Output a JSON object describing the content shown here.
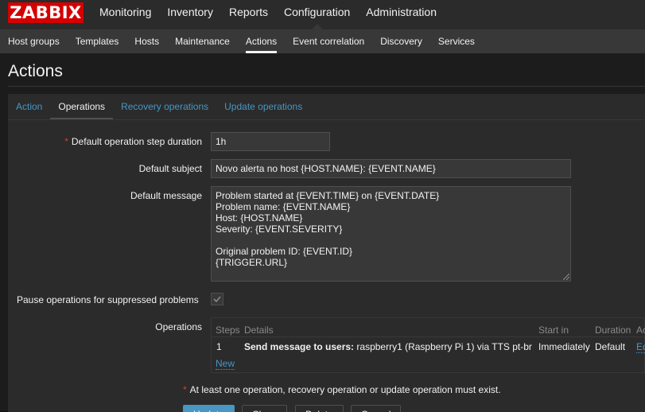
{
  "logo": "ZABBIX",
  "main_menu": [
    "Monitoring",
    "Inventory",
    "Reports",
    "Configuration",
    "Administration"
  ],
  "sub_menu": [
    "Host groups",
    "Templates",
    "Hosts",
    "Maintenance",
    "Actions",
    "Event correlation",
    "Discovery",
    "Services"
  ],
  "page_title": "Actions",
  "tabs": [
    "Action",
    "Operations",
    "Recovery operations",
    "Update operations"
  ],
  "form": {
    "step_duration_label": "Default operation step duration",
    "required_mark": "*",
    "step_duration_value": "1h",
    "subject_label": "Default subject",
    "subject_value": "Novo alerta no host {HOST.NAME}: {EVENT.NAME}",
    "message_label": "Default message",
    "message_value": "Problem started at {EVENT.TIME} on {EVENT.DATE}\nProblem name: {EVENT.NAME}\nHost: {HOST.NAME}\nSeverity: {EVENT.SEVERITY}\n\nOriginal problem ID: {EVENT.ID}\n{TRIGGER.URL}",
    "pause_label": "Pause operations for suppressed problems",
    "pause_checked": true,
    "operations_label": "Operations"
  },
  "operations": {
    "headers": [
      "Steps",
      "Details",
      "Start in",
      "Duration",
      "Ac"
    ],
    "rows": [
      {
        "steps": "1",
        "details_bold": "Send message to users:",
        "details_rest": " raspberry1 (Raspberry Pi 1) via TTS pt-br",
        "start_in": "Immediately",
        "duration": "Default",
        "action": "Ed"
      }
    ],
    "new_link": "New"
  },
  "note": "At least one operation, recovery operation or update operation must exist.",
  "buttons": [
    "Update",
    "Clone",
    "Delete",
    "Cancel"
  ],
  "colors": {
    "accent": "#4796c4",
    "logo_red": "#d40000",
    "required": "#e33734"
  }
}
